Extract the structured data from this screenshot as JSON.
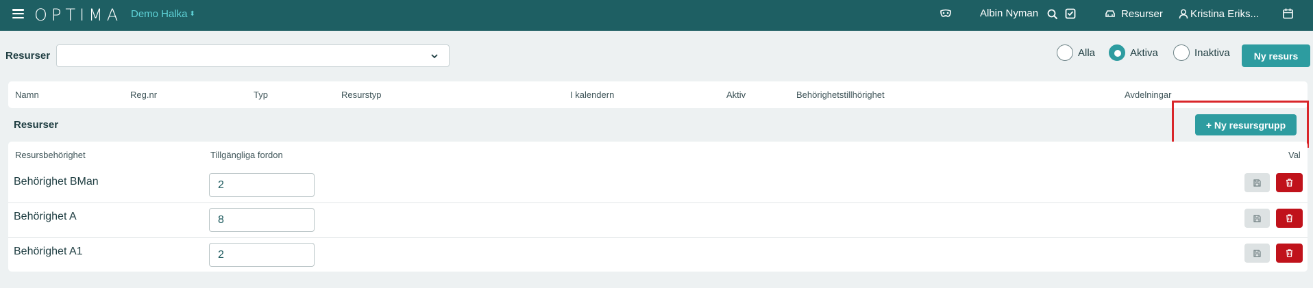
{
  "topbar": {
    "logo": "OPTIMA",
    "project": "Demo Halka",
    "user_left": "Albin Nyman",
    "resources_link": "Resurser",
    "user_right": "Kristina Eriks..."
  },
  "filter": {
    "label": "Resurser",
    "select_value": "",
    "radios": [
      {
        "label": "Alla",
        "selected": false
      },
      {
        "label": "Aktiva",
        "selected": true
      },
      {
        "label": "Inaktiva",
        "selected": false
      }
    ],
    "new_button": "Ny resurs"
  },
  "resource_table": {
    "columns": [
      "Namn",
      "Reg.nr",
      "Typ",
      "Resurstyp",
      "I kalendern",
      "Aktiv",
      "Behörighetstillhörighet",
      "Avdelningar"
    ]
  },
  "groups": {
    "title": "Resurser",
    "new_group_button": "+ Ny resursgrupp",
    "columns": [
      "Resursbehörighet",
      "Tillgängliga fordon",
      "Val"
    ],
    "rows": [
      {
        "name": "Behörighet BMan",
        "vehicles": "2"
      },
      {
        "name": "Behörighet A",
        "vehicles": "8"
      },
      {
        "name": "Behörighet A1",
        "vehicles": "2"
      }
    ]
  },
  "colors": {
    "topbar": "#1e5f63",
    "accent": "#2d9ca0",
    "danger": "#c0121b",
    "highlight": "#d9262a"
  }
}
